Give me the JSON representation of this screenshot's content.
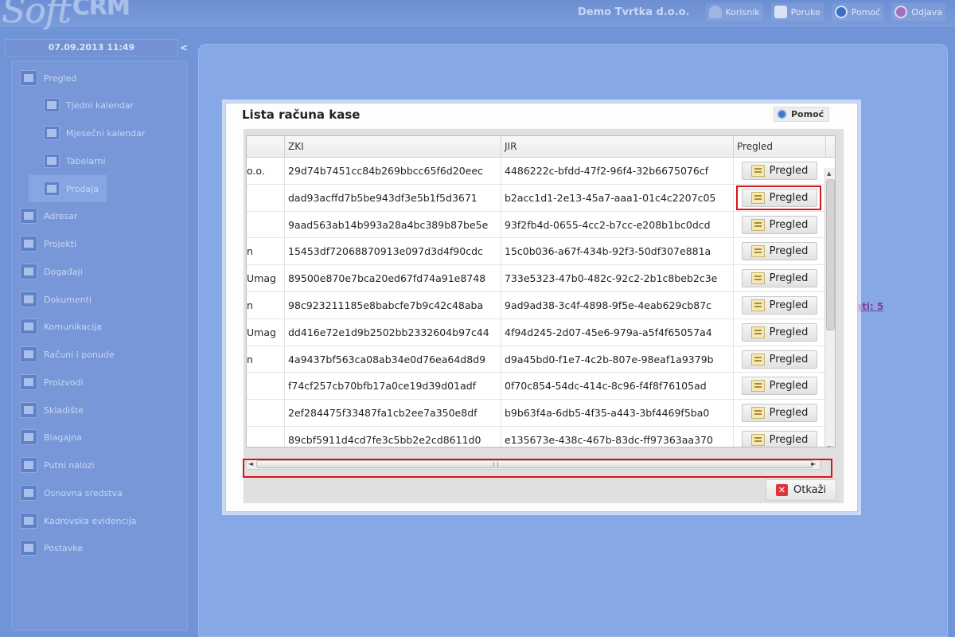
{
  "app": {
    "logo_main": "Soft",
    "logo_suffix": "CRM",
    "company": "Demo Tvrtka d.o.o."
  },
  "toplinks": [
    {
      "label": "Korisnik",
      "icon": "user-icon"
    },
    {
      "label": "Poruke",
      "icon": "message-icon"
    },
    {
      "label": "Pomoć",
      "icon": "help-icon"
    },
    {
      "label": "Odjava",
      "icon": "power-icon"
    }
  ],
  "sidebar": {
    "datetime": "07.09.2013 11:49",
    "collapse": "<",
    "items": [
      {
        "label": "Pregled",
        "icon": "overview-icon",
        "sub": false
      },
      {
        "label": "Tjedni kalendar",
        "icon": "calendar-icon",
        "sub": true
      },
      {
        "label": "Mjesečni kalendar",
        "icon": "calendar-icon",
        "sub": true
      },
      {
        "label": "Tabelarni",
        "icon": "table-icon",
        "sub": true
      },
      {
        "label": "Prodaja",
        "icon": "chart-icon",
        "sub": true,
        "active": true
      },
      {
        "label": "Adresar",
        "icon": "contacts-icon",
        "sub": false
      },
      {
        "label": "Projekti",
        "icon": "projects-icon",
        "sub": false
      },
      {
        "label": "Događaji",
        "icon": "events-icon",
        "sub": false
      },
      {
        "label": "Dokumenti",
        "icon": "documents-icon",
        "sub": false
      },
      {
        "label": "Komunikacija",
        "icon": "communication-icon",
        "sub": false
      },
      {
        "label": "Računi i ponude",
        "icon": "invoices-icon",
        "sub": false
      },
      {
        "label": "Proizvodi",
        "icon": "products-icon",
        "sub": false
      },
      {
        "label": "Skladište",
        "icon": "warehouse-icon",
        "sub": false
      },
      {
        "label": "Blagajna",
        "icon": "cashbox-icon",
        "sub": false
      },
      {
        "label": "Putni nalozi",
        "icon": "travel-icon",
        "sub": false
      },
      {
        "label": "Osnovna sredstva",
        "icon": "assets-icon",
        "sub": false
      },
      {
        "label": "Kadrovska evidencija",
        "icon": "staff-icon",
        "sub": false
      },
      {
        "label": "Postavke",
        "icon": "settings-icon",
        "sub": false
      }
    ]
  },
  "background": {
    "partial_link": "ati: 5"
  },
  "modal": {
    "title": "Lista računa kase",
    "help_label": "Pomoć",
    "cancel_label": "Otkaži",
    "columns": [
      "",
      "ZKI",
      "JIR",
      "Pregled"
    ],
    "row_button_label": "Pregled",
    "rows": [
      {
        "c0": "o.o.",
        "zki": "29d74b7451cc84b269bbcc65f6d20eec",
        "jir": "4486222c-bfdd-47f2-96f4-32b6675076cf"
      },
      {
        "c0": "",
        "zki": "dad93acffd7b5be943df3e5b1f5d3671",
        "jir": "b2acc1d1-2e13-45a7-aaa1-01c4c2207c05"
      },
      {
        "c0": "",
        "zki": "9aad563ab14b993a28a4bc389b87be5e",
        "jir": "93f2fb4d-0655-4cc2-b7cc-e208b1bc0dcd"
      },
      {
        "c0": "n",
        "zki": "15453df72068870913e097d3d4f90cdc",
        "jir": "15c0b036-a67f-434b-92f3-50df307e881a"
      },
      {
        "c0": "Umag",
        "zki": "89500e870e7bca20ed67fd74a91e8748",
        "jir": "733e5323-47b0-482c-92c2-2b1c8beb2c3e"
      },
      {
        "c0": "n",
        "zki": "98c923211185e8babcfe7b9c42c48aba",
        "jir": "9ad9ad38-3c4f-4898-9f5e-4eab629cb87c"
      },
      {
        "c0": "Umag",
        "zki": "dd416e72e1d9b2502bb2332604b97c44",
        "jir": "4f94d245-2d07-45e6-979a-a5f4f65057a4"
      },
      {
        "c0": "n",
        "zki": "4a9437bf563ca08ab34e0d76ea64d8d9",
        "jir": "d9a45bd0-f1e7-4c2b-807e-98eaf1a9379b"
      },
      {
        "c0": "",
        "zki": "f74cf257cb70bfb17a0ce19d39d01adf",
        "jir": "0f70c854-54dc-414c-8c96-f4f8f76105ad"
      },
      {
        "c0": "",
        "zki": "2ef284475f33487fa1cb2ee7a350e8df",
        "jir": "b9b63f4a-6db5-4f35-a443-3bf4469f5ba0"
      },
      {
        "c0": "",
        "zki": "89cbf5911d4cd7fe3c5bb2e2cd8611d0",
        "jir": "e135673e-438c-467b-83dc-ff97363aa370"
      }
    ]
  },
  "colors": {
    "background": "#6f94d8",
    "highlight": "#d9141b",
    "link": "#7a3f9f"
  }
}
